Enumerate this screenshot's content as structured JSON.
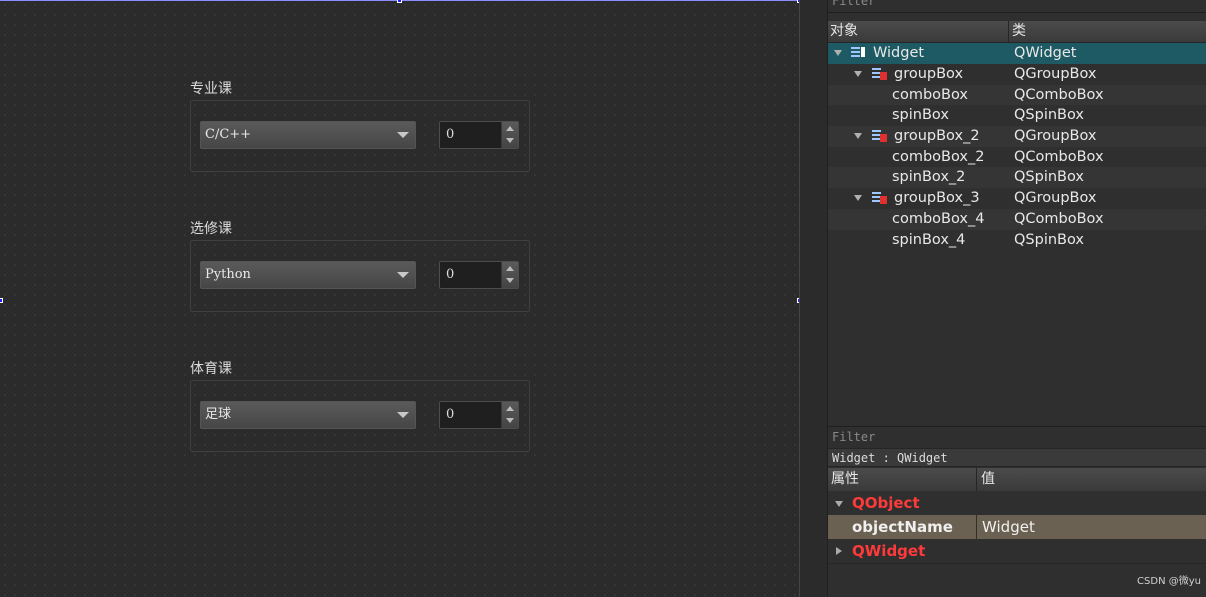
{
  "canvas": {
    "groups": [
      {
        "title": "专业课",
        "combo": "C/C++",
        "spin": "0"
      },
      {
        "title": "选修课",
        "combo": "Python",
        "spin": "0"
      },
      {
        "title": "体育课",
        "combo": "足球",
        "spin": "0"
      }
    ]
  },
  "object_inspector": {
    "filter_placeholder": "Filter",
    "columns": {
      "object": "对象",
      "class": "类"
    },
    "rows": [
      {
        "name": "Widget",
        "cls": "QWidget"
      },
      {
        "name": "groupBox",
        "cls": "QGroupBox"
      },
      {
        "name": "comboBox",
        "cls": "QComboBox"
      },
      {
        "name": "spinBox",
        "cls": "QSpinBox"
      },
      {
        "name": "groupBox_2",
        "cls": "QGroupBox"
      },
      {
        "name": "comboBox_2",
        "cls": "QComboBox"
      },
      {
        "name": "spinBox_2",
        "cls": "QSpinBox"
      },
      {
        "name": "groupBox_3",
        "cls": "QGroupBox"
      },
      {
        "name": "comboBox_4",
        "cls": "QComboBox"
      },
      {
        "name": "spinBox_4",
        "cls": "QSpinBox"
      }
    ]
  },
  "property_editor": {
    "filter_placeholder": "Filter",
    "object_label": "Widget : QWidget",
    "columns": {
      "property": "属性",
      "value": "值"
    },
    "categories": {
      "qobject": "QObject",
      "qwidget": "QWidget"
    },
    "object_name": {
      "key": "objectName",
      "value": "Widget"
    }
  },
  "watermark": "CSDN @微yu",
  "colors": {
    "selection": "#1e5a63",
    "category": "#ff3a3a",
    "object_name_row": "#6b6152"
  }
}
